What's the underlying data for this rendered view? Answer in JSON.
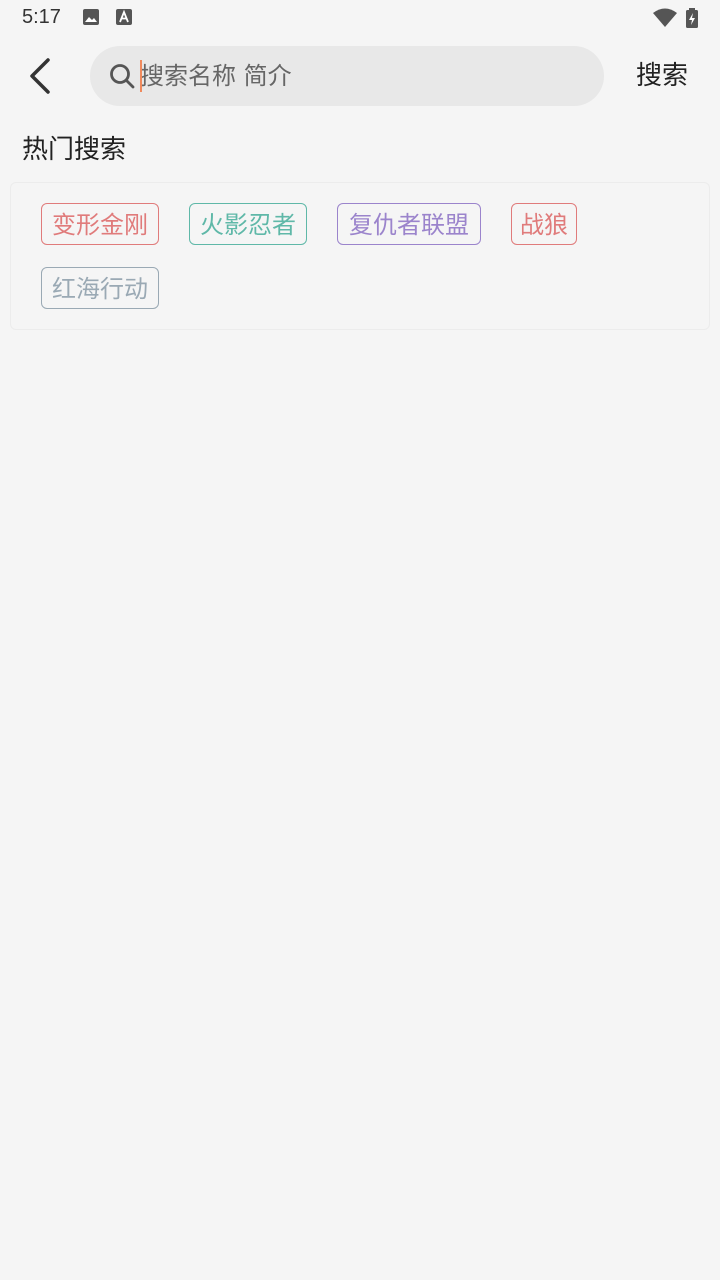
{
  "status_bar": {
    "time": "5:17",
    "icons": [
      "image-icon",
      "text-a-icon",
      "wifi-icon",
      "battery-icon"
    ]
  },
  "search": {
    "placeholder": "搜索名称 简介",
    "value": "",
    "button_label": "搜索"
  },
  "hot_search": {
    "title": "热门搜索",
    "tags": [
      {
        "label": "变形金刚",
        "color": "#e07b7b"
      },
      {
        "label": "火影忍者",
        "color": "#5fb8a8"
      },
      {
        "label": "复仇者联盟",
        "color": "#9b84cc"
      },
      {
        "label": "战狼",
        "color": "#e07b7b"
      },
      {
        "label": "红海行动",
        "color": "#9aa9b4"
      }
    ]
  }
}
